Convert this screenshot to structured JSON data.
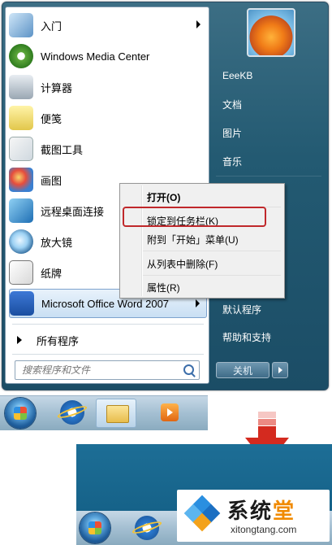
{
  "start_menu": {
    "programs": [
      {
        "label": "入门",
        "icon": "intro-icon",
        "has_submenu": true
      },
      {
        "label": "Windows Media Center",
        "icon": "media-center-icon",
        "has_submenu": false
      },
      {
        "label": "计算器",
        "icon": "calculator-icon",
        "has_submenu": false
      },
      {
        "label": "便笺",
        "icon": "sticky-notes-icon",
        "has_submenu": false
      },
      {
        "label": "截图工具",
        "icon": "snipping-tool-icon",
        "has_submenu": false
      },
      {
        "label": "画图",
        "icon": "paint-icon",
        "has_submenu": false
      },
      {
        "label": "远程桌面连接",
        "icon": "remote-desktop-icon",
        "has_submenu": false
      },
      {
        "label": "放大镜",
        "icon": "magnifier-icon",
        "has_submenu": false
      },
      {
        "label": "纸牌",
        "icon": "solitaire-icon",
        "has_submenu": false
      },
      {
        "label": "Microsoft Office Word 2007",
        "icon": "word-icon",
        "has_submenu": true
      }
    ],
    "all_programs": "所有程序",
    "search_placeholder": "搜索程序和文件",
    "right_links": [
      "EeeKB",
      "文档",
      "图片",
      "音乐",
      "默认程序",
      "帮助和支持"
    ],
    "shutdown_label": "关机"
  },
  "context_menu": {
    "items": [
      "打开(O)",
      "锁定到任务栏(K)",
      "附到「开始」菜单(U)",
      "从列表中删除(F)",
      "属性(R)"
    ],
    "highlighted": "锁定到任务栏(K)"
  },
  "watermark": {
    "text_main": "系统",
    "text_accent": "堂",
    "url": "xitongtang.com"
  },
  "colors": {
    "highlight_border": "#c0282b",
    "arrow": "#d42a1f",
    "start_frame": "#235a72"
  }
}
